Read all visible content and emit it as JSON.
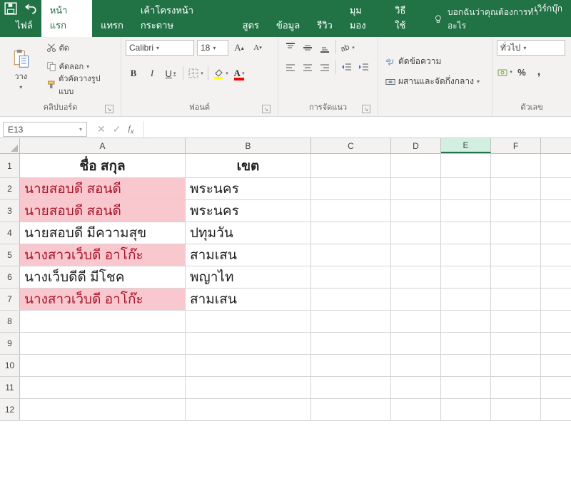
{
  "titlebar": {
    "book_title": "เวิร์กบุ๊ก"
  },
  "tabs": {
    "file": "ไฟล์",
    "home": "หน้าแรก",
    "insert": "แทรก",
    "layout": "เค้าโครงหน้ากระดาษ",
    "formulas": "สูตร",
    "data": "ข้อมูล",
    "review": "รีวิว",
    "view": "มุมมอง",
    "how": "วิธีใช้",
    "tell": "บอกฉันว่าคุณต้องการทำอะไร"
  },
  "ribbon": {
    "clipboard": {
      "paste": "วาง",
      "cut": "ตัด",
      "copy": "คัดลอก",
      "format_painter": "ตัวคัดวางรูปแบบ",
      "label": "คลิปบอร์ด"
    },
    "font": {
      "name": "Calibri",
      "size": "18",
      "grow": "A",
      "shrink": "A",
      "bold": "B",
      "italic": "I",
      "underline": "U",
      "label": "ฟอนต์"
    },
    "align": {
      "label": "การจัดแนว"
    },
    "editing": {
      "wrap": "ตัดข้อความ",
      "merge": "ผสานและจัดกึ่งกลาง"
    },
    "number": {
      "format": "ทั่วไป",
      "label": "ตัวเลข"
    }
  },
  "namebox": "E13",
  "sheet": {
    "columns": [
      "A",
      "B",
      "C",
      "D",
      "E",
      "F"
    ],
    "rows": [
      1,
      2,
      3,
      4,
      5,
      6,
      7,
      8,
      9,
      10,
      11,
      12
    ],
    "data": [
      {
        "r": 1,
        "A": "ชื่อ สกุล",
        "B": "เขต",
        "hdr": true
      },
      {
        "r": 2,
        "A": "นายสอบดี สอนดี",
        "B": "พระนคร",
        "hlA": true
      },
      {
        "r": 3,
        "A": "นายสอบดี สอนดี",
        "B": "พระนคร",
        "hlA": true
      },
      {
        "r": 4,
        "A": "นายสอบดี มีความสุข",
        "B": "ปทุมวัน"
      },
      {
        "r": 5,
        "A": "นางสาวเว็บดี อาโก๊ะ",
        "B": "สามเสน",
        "hlA": true
      },
      {
        "r": 6,
        "A": "นางเว็บดีดี มีโชค",
        "B": "พญาไท"
      },
      {
        "r": 7,
        "A": "นางสาวเว็บดี อาโก๊ะ",
        "B": "สามเสน",
        "hlA": true
      },
      {
        "r": 8
      },
      {
        "r": 9
      },
      {
        "r": 10
      },
      {
        "r": 11
      },
      {
        "r": 12
      }
    ]
  }
}
